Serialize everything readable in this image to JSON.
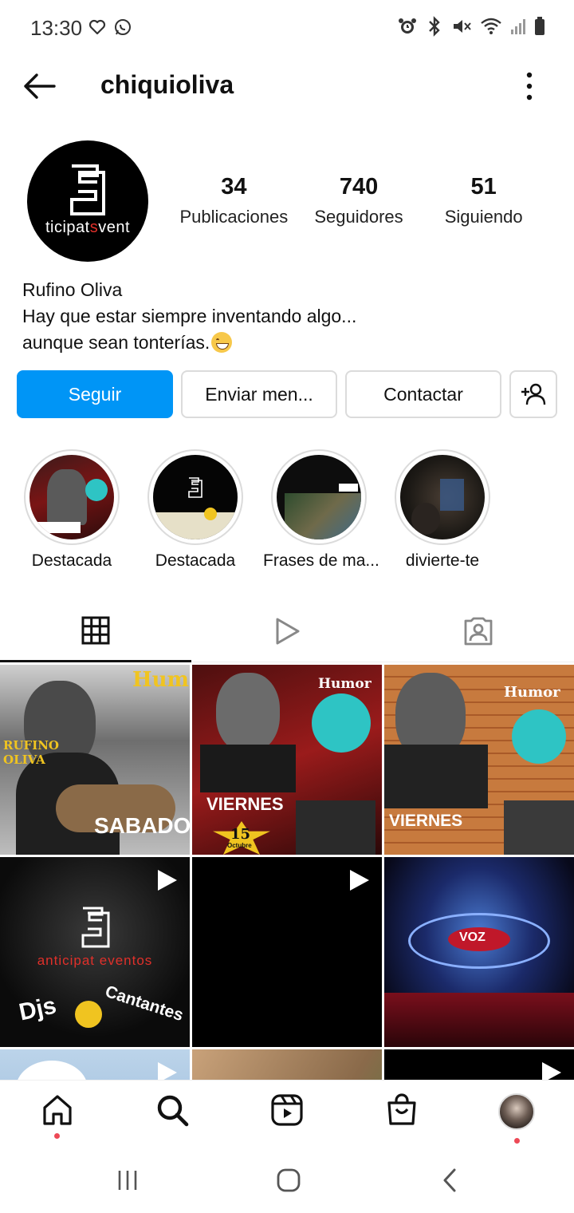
{
  "status_bar": {
    "time": "13:30",
    "left_icons": [
      "heart-outline-icon",
      "whatsapp-icon"
    ],
    "right_icons": [
      "alarm-icon",
      "bluetooth-icon",
      "mute-icon",
      "wifi-icon",
      "signal-icon",
      "battery-icon"
    ]
  },
  "header": {
    "username": "chiquioliva"
  },
  "profile": {
    "avatar_text_a": "ticipat",
    "avatar_text_b": "s",
    "avatar_text_c": "vent",
    "stats": [
      {
        "value": "34",
        "label": "Publicaciones"
      },
      {
        "value": "740",
        "label": "Seguidores"
      },
      {
        "value": "51",
        "label": "Siguiendo"
      }
    ],
    "bio": {
      "name": "Rufino Oliva",
      "line1": "Hay que estar siempre inventando algo...",
      "line2": "aunque sean tonterías."
    }
  },
  "actions": {
    "follow": "Seguir",
    "message": "Enviar men...",
    "contact": "Contactar"
  },
  "highlights": [
    {
      "label": "Destacada"
    },
    {
      "label": "Destacada"
    },
    {
      "label": "Frases de ma..."
    },
    {
      "label": "divierte-te"
    }
  ],
  "grid": {
    "tile1_text": "SABADO",
    "tile1_name": "RUFINO OLIVA",
    "tile1_hum": "Hum",
    "tile2_text": "VIERNES",
    "tile2_num": "15",
    "tile2_month": "Octubre",
    "tile2_hum": "Humor",
    "tile3_text": "VIERNES",
    "tile3_hum": "Humor",
    "tile4_brand": "anticipat eventos",
    "tile4_djs": "Djs",
    "tile4_cant": "Cantantes",
    "tile6_text": "VOZ"
  },
  "colors": {
    "accent_blue": "#0095f6",
    "notification_red": "#ed4956"
  }
}
